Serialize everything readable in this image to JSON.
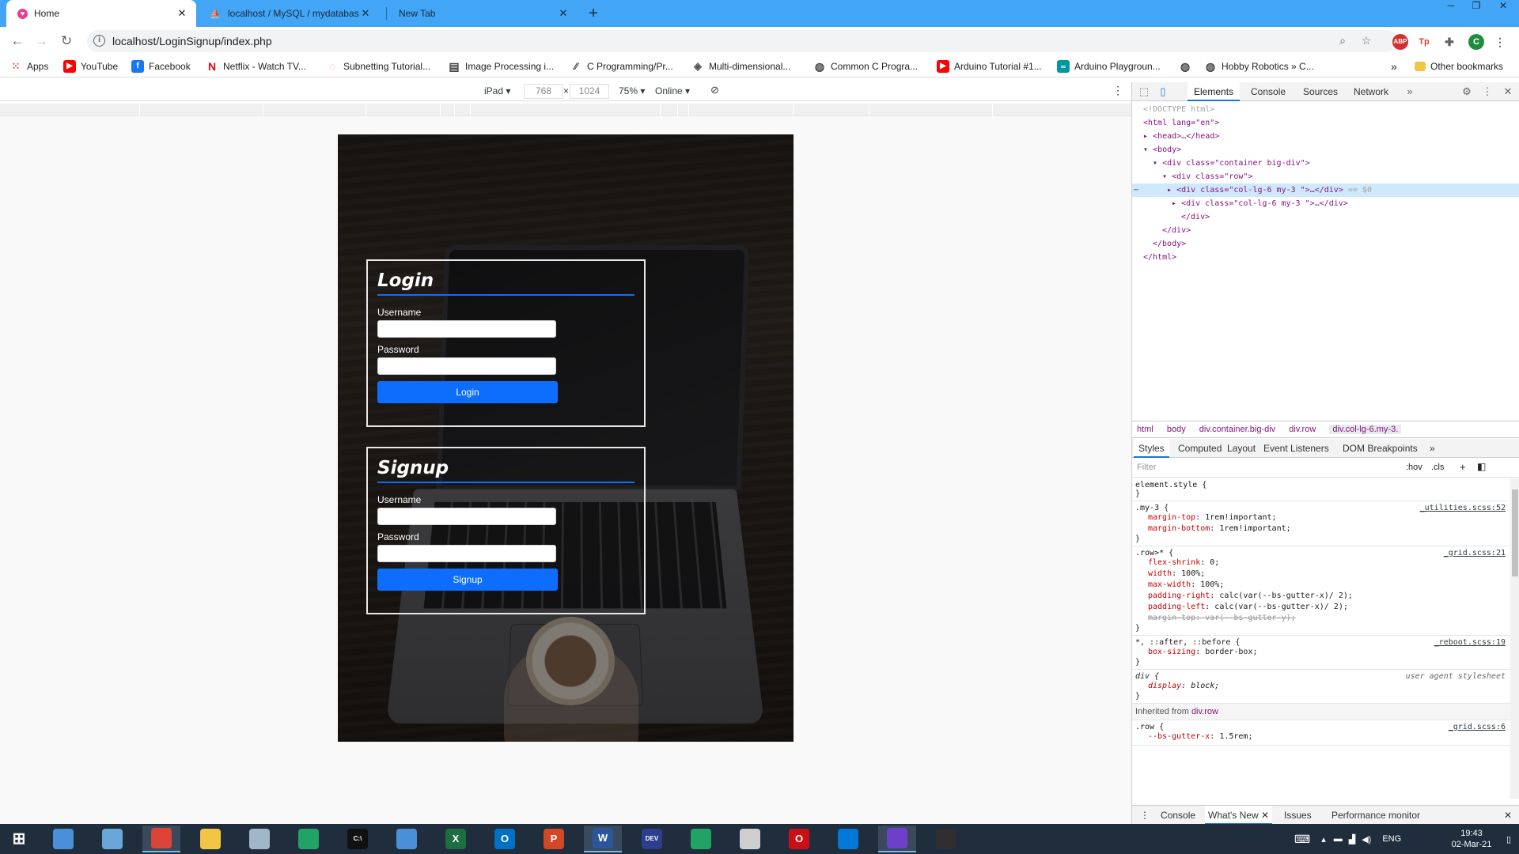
{
  "browser": {
    "tabs": [
      {
        "title": "Home",
        "active": true,
        "icon": "heart-favicon-icon"
      },
      {
        "title": "localhost / MySQL / mydatabase",
        "active": false,
        "icon": "phpmyadmin-favicon-icon"
      },
      {
        "title": "New Tab",
        "active": false,
        "icon": ""
      }
    ],
    "new_tab_symbol": "+",
    "url": "localhost/LoginSignup/index.php"
  },
  "bookmarks": [
    {
      "label": "Apps",
      "icon": "apps-grid-icon",
      "color": "#ea4335"
    },
    {
      "label": "YouTube",
      "icon": "youtube-icon",
      "color": "#ff0000"
    },
    {
      "label": "Facebook",
      "icon": "facebook-icon",
      "color": "#1877f2"
    },
    {
      "label": "Netflix - Watch TV...",
      "icon": "netflix-icon",
      "color": "#e50914"
    },
    {
      "label": "Subnetting Tutorial...",
      "icon": "globe-icon",
      "color": "#f28b82"
    },
    {
      "label": "Image Processing i...",
      "icon": "book-icon",
      "color": "#444444"
    },
    {
      "label": "C Programming/Pr...",
      "icon": "wiki-icon",
      "color": "#333333"
    },
    {
      "label": "Multi-dimensional...",
      "icon": "diamond-icon",
      "color": "#555555"
    },
    {
      "label": "Common C Progra...",
      "icon": "globe-icon",
      "color": "#444444"
    },
    {
      "label": "Arduino Tutorial #1...",
      "icon": "youtube-icon",
      "color": "#ff0000"
    },
    {
      "label": "Arduino Playgroun...",
      "icon": "arduino-icon",
      "color": "#00979d"
    },
    {
      "label": "",
      "icon": "globe-icon",
      "color": "#444444"
    },
    {
      "label": "Hobby Robotics » C...",
      "icon": "globe-icon",
      "color": "#444444"
    }
  ],
  "other_bookmarks": "Other bookmarks",
  "overflow_symbol": "»",
  "device_toolbar": {
    "device": "iPad ▾",
    "width": "768",
    "times": "×",
    "height": "1024",
    "zoom": "75% ▾",
    "network": "Online ▾"
  },
  "page": {
    "login": {
      "title": "Login",
      "username_label": "Username",
      "password_label": "Password",
      "button": "Login"
    },
    "signup": {
      "title": "Signup",
      "username_label": "Username",
      "password_label": "Password",
      "button": "Signup"
    }
  },
  "devtools": {
    "tabs": [
      "Elements",
      "Console",
      "Sources",
      "Network"
    ],
    "active_tab": "Elements",
    "dom": {
      "doctype": "<!DOCTYPE html>",
      "html_open": "<html lang=\"en\">",
      "head": "<head>…</head>",
      "body_open": "<body>",
      "container": "<div class=\"container big-div\">",
      "row": "<div class=\"row\">",
      "col1": "<div class=\"col-lg-6 my-3 \">…</div>",
      "col1_suffix": "== $0",
      "col2": "<div class=\"col-lg-6 my-3 \">…</div>",
      "div_close": "</div>",
      "div_close2": "</div>",
      "body_close": "</body>",
      "html_close": "</html>"
    },
    "breadcrumbs": [
      "html",
      "body",
      "div.container.big-div",
      "div.row",
      "div.col-lg-6.my-3."
    ],
    "subtabs": [
      "Styles",
      "Computed",
      "Layout",
      "Event Listeners",
      "DOM Breakpoints"
    ],
    "filter_placeholder": "Filter",
    "filter_buttons": {
      "hov": ":hov",
      "cls": ".cls",
      "plus": "+"
    },
    "rules": {
      "element_style": "element.style {",
      "close": "}",
      "my3": {
        "selector": ".my-3 {",
        "source": "_utilities.scss:52",
        "p1n": "margin-top",
        "p1v": "1rem!important;",
        "p2n": "margin-bottom",
        "p2v": "1rem!important;"
      },
      "row_child": {
        "selector": ".row>* {",
        "source": "_grid.scss:21",
        "p1n": "flex-shrink",
        "p1v": "0;",
        "p2n": "width",
        "p2v": "100%;",
        "p3n": "max-width",
        "p3v": "100%;",
        "p4n": "padding-right",
        "p4v": "calc(var(--bs-gutter-x)/ 2);",
        "p5n": "padding-left",
        "p5v": "calc(var(--bs-gutter-x)/ 2);",
        "p6n": "margin-top",
        "p6v": "var(--bs-gutter-y);"
      },
      "universal": {
        "selector": "*, ::after, ::before {",
        "source": "_reboot.scss:19",
        "p1n": "box-sizing",
        "p1v": "border-box;"
      },
      "div_ua": {
        "selector": "div {",
        "source": "user agent stylesheet",
        "p1n": "display",
        "p1v": "block;"
      },
      "inherited_label": "Inherited from",
      "inherited_from": "div.row",
      "row": {
        "selector": ".row {",
        "source": "_grid.scss:6",
        "p1n": "--bs-gutter-x",
        "p1v": "1.5rem;"
      }
    },
    "drawer": [
      "Console",
      "What's New",
      "Issues",
      "Performance monitor"
    ],
    "drawer_active": "What's New"
  },
  "taskbar": {
    "apps": [
      {
        "name": "file-explorer-notepad",
        "label": "",
        "color": "#4a90d9"
      },
      {
        "name": "paint",
        "label": "",
        "color": "#6aa7d8"
      },
      {
        "name": "chrome",
        "label": "",
        "color": "#db4437"
      },
      {
        "name": "file-explorer",
        "label": "",
        "color": "#f4c542"
      },
      {
        "name": "notes",
        "label": "",
        "color": "#9fb7c8"
      },
      {
        "name": "project",
        "label": "",
        "color": "#21a366"
      },
      {
        "name": "terminal",
        "label": "C:\\",
        "color": "#111111"
      },
      {
        "name": "remote-desktop",
        "label": "",
        "color": "#4a90d9"
      },
      {
        "name": "excel",
        "label": "X",
        "color": "#1d6f42"
      },
      {
        "name": "outlook",
        "label": "O",
        "color": "#0072c6"
      },
      {
        "name": "powerpoint",
        "label": "P",
        "color": "#d24726"
      },
      {
        "name": "word",
        "label": "W",
        "color": "#2b579a"
      },
      {
        "name": "dev-cpp",
        "label": "DEV",
        "color": "#2c3e8c"
      },
      {
        "name": "calculator",
        "label": "",
        "color": "#21a366"
      },
      {
        "name": "snipping",
        "label": "",
        "color": "#cfcfcf"
      },
      {
        "name": "opera",
        "label": "O",
        "color": "#cc0f16"
      },
      {
        "name": "vscode",
        "label": "",
        "color": "#0078d7"
      },
      {
        "name": "github",
        "label": "",
        "color": "#6e40c9"
      },
      {
        "name": "obs",
        "label": "",
        "color": "#302e31"
      }
    ],
    "language": "ENG",
    "time": "19:43",
    "date": "02-Mar-21"
  }
}
